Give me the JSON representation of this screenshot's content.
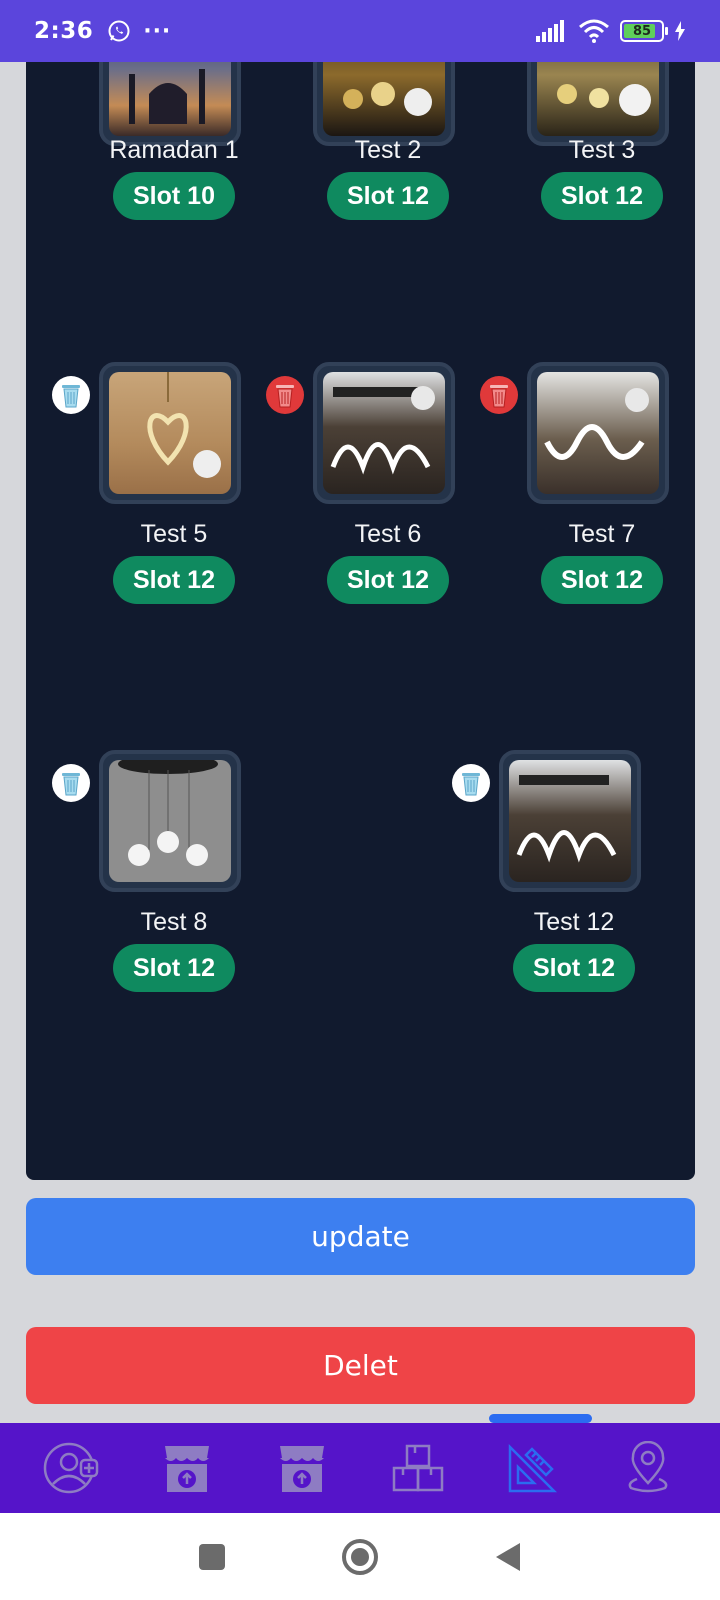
{
  "status_bar": {
    "time": "2:36",
    "dots": "···",
    "battery_level": "85",
    "battery_percent": 85,
    "colors": {
      "bar": "#5b45dc",
      "battery_fill": "#5fcf5b"
    }
  },
  "grid": {
    "items": [
      {
        "name": "Ramadan 1",
        "slot": "Slot 10",
        "trash": "none",
        "thumb": "mosque-photo"
      },
      {
        "name": "Test 2",
        "slot": "Slot 12",
        "trash": "none",
        "thumb": "lamp-shop-photo"
      },
      {
        "name": "Test 3",
        "slot": "Slot 12",
        "trash": "none",
        "thumb": "lamp-shop-photo"
      },
      {
        "name": "Test 5",
        "slot": "Slot 12",
        "trash": "white",
        "thumb": "heart-chandelier-photo"
      },
      {
        "name": "Test 6",
        "slot": "Slot 12",
        "trash": "red",
        "thumb": "ring-chandelier-photo"
      },
      {
        "name": "Test 7",
        "slot": "Slot 12",
        "trash": "red",
        "thumb": "wave-chandelier-photo"
      },
      {
        "name": "Test 8",
        "slot": "Slot 12",
        "trash": "white",
        "thumb": "ball-pendant-photo"
      },
      {
        "name": "Test 12",
        "slot": "Slot 12",
        "trash": "white",
        "thumb": "ring-chandelier-photo"
      }
    ],
    "colors": {
      "panel": "#111a2e",
      "slot_badge": "#0f8a5f",
      "trash_red": "#e0393a"
    }
  },
  "actions": {
    "update_label": "update",
    "delete_label": "Delet",
    "colors": {
      "update": "#3d7ff0",
      "delete": "#ef4447"
    }
  },
  "bottom_nav": {
    "items": [
      {
        "icon": "add-user-icon",
        "active": false
      },
      {
        "icon": "store-upload-icon",
        "active": false
      },
      {
        "icon": "store-upload-icon",
        "active": false
      },
      {
        "icon": "boxes-icon",
        "active": false
      },
      {
        "icon": "design-tools-icon",
        "active": true
      },
      {
        "icon": "location-pin-icon",
        "active": false
      }
    ],
    "colors": {
      "bar": "#5514c9",
      "active": "#2b6cf0",
      "inactive": "#8e7cc3"
    }
  },
  "system_nav": {
    "buttons": [
      "recents-icon",
      "home-icon",
      "back-icon"
    ]
  }
}
